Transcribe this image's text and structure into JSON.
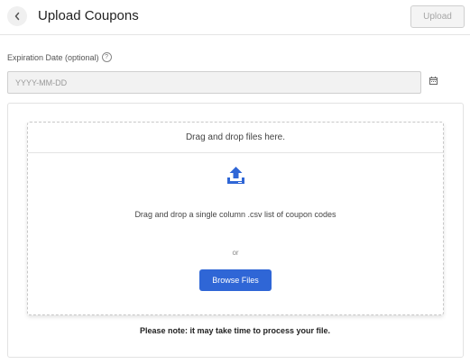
{
  "header": {
    "title": "Upload Coupons",
    "upload_label": "Upload",
    "back_icon": "chevron-left-icon"
  },
  "expiration": {
    "label": "Expiration Date (optional)",
    "help_icon": "question-circle-icon",
    "placeholder": "YYYY-MM-DD",
    "value": "",
    "calendar_icon": "calendar-icon"
  },
  "dropzone": {
    "header": "Drag and drop files here.",
    "icon": "upload-tray-icon",
    "instructions": "Drag and drop a single column .csv list of coupon codes",
    "or_text": "or",
    "browse_label": "Browse Files"
  },
  "note": "Please note: it may take time to process your file.",
  "colors": {
    "primary": "#2f66d6",
    "disabled_text": "#a6a6a6",
    "input_bg": "#f2f2f2"
  }
}
